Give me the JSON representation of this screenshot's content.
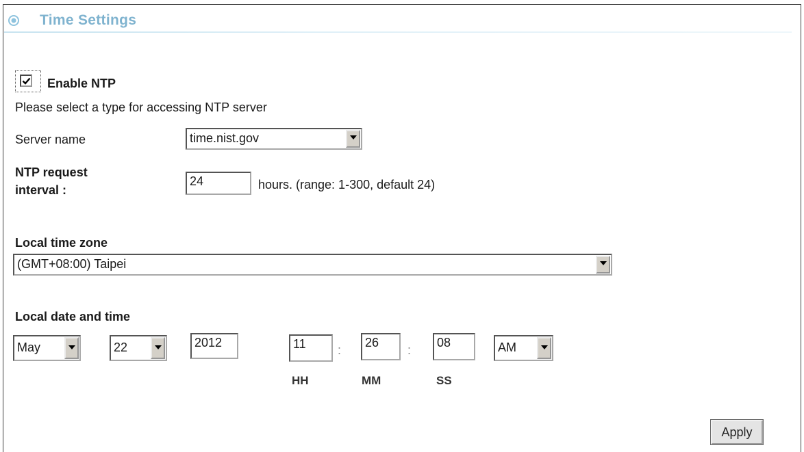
{
  "header": {
    "title": "Time Settings",
    "icon": "target-icon"
  },
  "ntp": {
    "enable_label": "Enable NTP",
    "enabled": true,
    "instruction": "Please select a type for accessing NTP server",
    "server_label": "Server name",
    "server_value": "time.nist.gov",
    "interval_label_line1": "NTP request",
    "interval_label_line2": "interval :",
    "interval_value": "24",
    "interval_hint": "hours. (range: 1-300, default 24)"
  },
  "timezone": {
    "label": "Local time zone",
    "value": "(GMT+08:00) Taipei"
  },
  "datetime": {
    "label": "Local date and time",
    "month": "May",
    "day": "22",
    "year": "2012",
    "hour": "11",
    "minute": "26",
    "second": "08",
    "ampm": "AM",
    "separator": ":",
    "hh_label": "HH",
    "mm_label": "MM",
    "ss_label": "SS"
  },
  "actions": {
    "apply_label": "Apply"
  },
  "colors": {
    "title": "#7fb3cf",
    "header_line": "#c8e3f0"
  }
}
